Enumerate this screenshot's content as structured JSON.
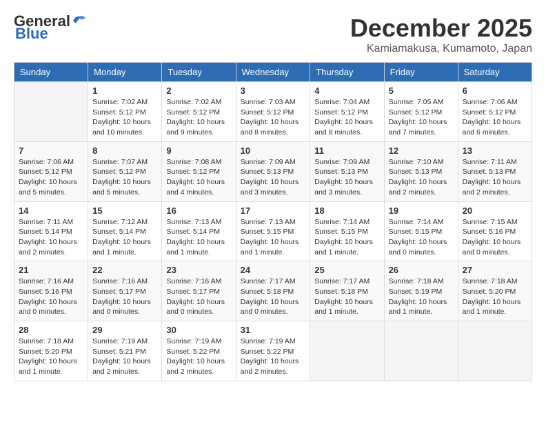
{
  "logo": {
    "line1": "General",
    "line2": "Blue"
  },
  "title": "December 2025",
  "location": "Kamiamakusa, Kumamoto, Japan",
  "weekdays": [
    "Sunday",
    "Monday",
    "Tuesday",
    "Wednesday",
    "Thursday",
    "Friday",
    "Saturday"
  ],
  "weeks": [
    [
      {
        "day": "",
        "info": ""
      },
      {
        "day": "1",
        "info": "Sunrise: 7:02 AM\nSunset: 5:12 PM\nDaylight: 10 hours\nand 10 minutes."
      },
      {
        "day": "2",
        "info": "Sunrise: 7:02 AM\nSunset: 5:12 PM\nDaylight: 10 hours\nand 9 minutes."
      },
      {
        "day": "3",
        "info": "Sunrise: 7:03 AM\nSunset: 5:12 PM\nDaylight: 10 hours\nand 8 minutes."
      },
      {
        "day": "4",
        "info": "Sunrise: 7:04 AM\nSunset: 5:12 PM\nDaylight: 10 hours\nand 8 minutes."
      },
      {
        "day": "5",
        "info": "Sunrise: 7:05 AM\nSunset: 5:12 PM\nDaylight: 10 hours\nand 7 minutes."
      },
      {
        "day": "6",
        "info": "Sunrise: 7:06 AM\nSunset: 5:12 PM\nDaylight: 10 hours\nand 6 minutes."
      }
    ],
    [
      {
        "day": "7",
        "info": "Sunrise: 7:06 AM\nSunset: 5:12 PM\nDaylight: 10 hours\nand 5 minutes."
      },
      {
        "day": "8",
        "info": "Sunrise: 7:07 AM\nSunset: 5:12 PM\nDaylight: 10 hours\nand 5 minutes."
      },
      {
        "day": "9",
        "info": "Sunrise: 7:08 AM\nSunset: 5:12 PM\nDaylight: 10 hours\nand 4 minutes."
      },
      {
        "day": "10",
        "info": "Sunrise: 7:09 AM\nSunset: 5:13 PM\nDaylight: 10 hours\nand 3 minutes."
      },
      {
        "day": "11",
        "info": "Sunrise: 7:09 AM\nSunset: 5:13 PM\nDaylight: 10 hours\nand 3 minutes."
      },
      {
        "day": "12",
        "info": "Sunrise: 7:10 AM\nSunset: 5:13 PM\nDaylight: 10 hours\nand 2 minutes."
      },
      {
        "day": "13",
        "info": "Sunrise: 7:11 AM\nSunset: 5:13 PM\nDaylight: 10 hours\nand 2 minutes."
      }
    ],
    [
      {
        "day": "14",
        "info": "Sunrise: 7:11 AM\nSunset: 5:14 PM\nDaylight: 10 hours\nand 2 minutes."
      },
      {
        "day": "15",
        "info": "Sunrise: 7:12 AM\nSunset: 5:14 PM\nDaylight: 10 hours\nand 1 minute."
      },
      {
        "day": "16",
        "info": "Sunrise: 7:13 AM\nSunset: 5:14 PM\nDaylight: 10 hours\nand 1 minute."
      },
      {
        "day": "17",
        "info": "Sunrise: 7:13 AM\nSunset: 5:15 PM\nDaylight: 10 hours\nand 1 minute."
      },
      {
        "day": "18",
        "info": "Sunrise: 7:14 AM\nSunset: 5:15 PM\nDaylight: 10 hours\nand 1 minute."
      },
      {
        "day": "19",
        "info": "Sunrise: 7:14 AM\nSunset: 5:15 PM\nDaylight: 10 hours\nand 0 minutes."
      },
      {
        "day": "20",
        "info": "Sunrise: 7:15 AM\nSunset: 5:16 PM\nDaylight: 10 hours\nand 0 minutes."
      }
    ],
    [
      {
        "day": "21",
        "info": "Sunrise: 7:16 AM\nSunset: 5:16 PM\nDaylight: 10 hours\nand 0 minutes."
      },
      {
        "day": "22",
        "info": "Sunrise: 7:16 AM\nSunset: 5:17 PM\nDaylight: 10 hours\nand 0 minutes."
      },
      {
        "day": "23",
        "info": "Sunrise: 7:16 AM\nSunset: 5:17 PM\nDaylight: 10 hours\nand 0 minutes."
      },
      {
        "day": "24",
        "info": "Sunrise: 7:17 AM\nSunset: 5:18 PM\nDaylight: 10 hours\nand 0 minutes."
      },
      {
        "day": "25",
        "info": "Sunrise: 7:17 AM\nSunset: 5:18 PM\nDaylight: 10 hours\nand 1 minute."
      },
      {
        "day": "26",
        "info": "Sunrise: 7:18 AM\nSunset: 5:19 PM\nDaylight: 10 hours\nand 1 minute."
      },
      {
        "day": "27",
        "info": "Sunrise: 7:18 AM\nSunset: 5:20 PM\nDaylight: 10 hours\nand 1 minute."
      }
    ],
    [
      {
        "day": "28",
        "info": "Sunrise: 7:18 AM\nSunset: 5:20 PM\nDaylight: 10 hours\nand 1 minute."
      },
      {
        "day": "29",
        "info": "Sunrise: 7:19 AM\nSunset: 5:21 PM\nDaylight: 10 hours\nand 2 minutes."
      },
      {
        "day": "30",
        "info": "Sunrise: 7:19 AM\nSunset: 5:22 PM\nDaylight: 10 hours\nand 2 minutes."
      },
      {
        "day": "31",
        "info": "Sunrise: 7:19 AM\nSunset: 5:22 PM\nDaylight: 10 hours\nand 2 minutes."
      },
      {
        "day": "",
        "info": ""
      },
      {
        "day": "",
        "info": ""
      },
      {
        "day": "",
        "info": ""
      }
    ]
  ]
}
